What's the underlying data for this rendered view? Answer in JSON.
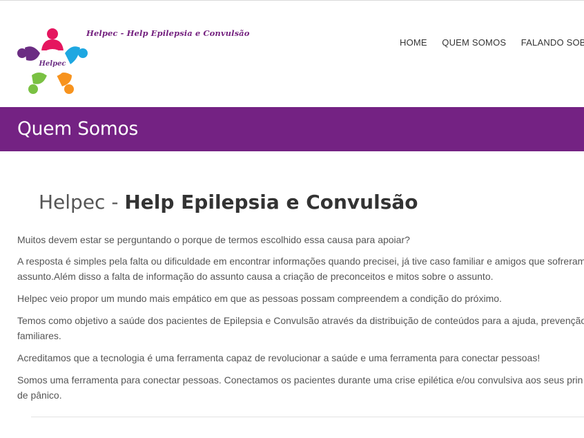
{
  "header": {
    "tagline": "Helpec - Help Epilepsia e Convulsão",
    "logo_text": "Helpec",
    "logo_colors": [
      "#e5165f",
      "#1ea7e1",
      "#f7931e",
      "#7ac143",
      "#6b2d83"
    ]
  },
  "nav": {
    "items": [
      {
        "label": "HOME"
      },
      {
        "label": "QUEM SOMOS"
      },
      {
        "label": "FALANDO SOBRE"
      }
    ]
  },
  "banner": {
    "title": "Quem Somos",
    "color": "#742283"
  },
  "main": {
    "heading_light": "Helpec - ",
    "heading_bold": "Help Epilepsia e Convulsão",
    "paragraphs": [
      {
        "lines": [
          "Muitos devem estar se perguntando o porque de termos escolhido essa causa para apoiar?"
        ]
      },
      {
        "lines": [
          "A resposta é simples pela falta ou dificuldade em encontrar informações quando precisei, já tive caso familiar e amigos que sofreram",
          "assunto.Além disso a falta de informação do assunto causa a criação de preconceitos e mitos sobre o assunto."
        ]
      },
      {
        "lines": [
          "Helpec veio propor um mundo mais empático em que as pessoas possam compreendem a condição do próximo."
        ]
      },
      {
        "lines": [
          "Temos como objetivo a saúde dos pacientes de Epilepsia e Convulsão através da distribuição de conteúdos para a ajuda, prevenção",
          "familiares."
        ]
      },
      {
        "lines": [
          "Acreditamos que a tecnologia é uma ferramenta capaz de revolucionar a saúde e uma ferramenta para conectar pessoas!"
        ]
      },
      {
        "lines": [
          "Somos uma ferramenta para conectar pessoas. Conectamos os pacientes durante uma crise epilética e/ou convulsiva aos seus prin",
          "de pânico."
        ]
      }
    ]
  }
}
